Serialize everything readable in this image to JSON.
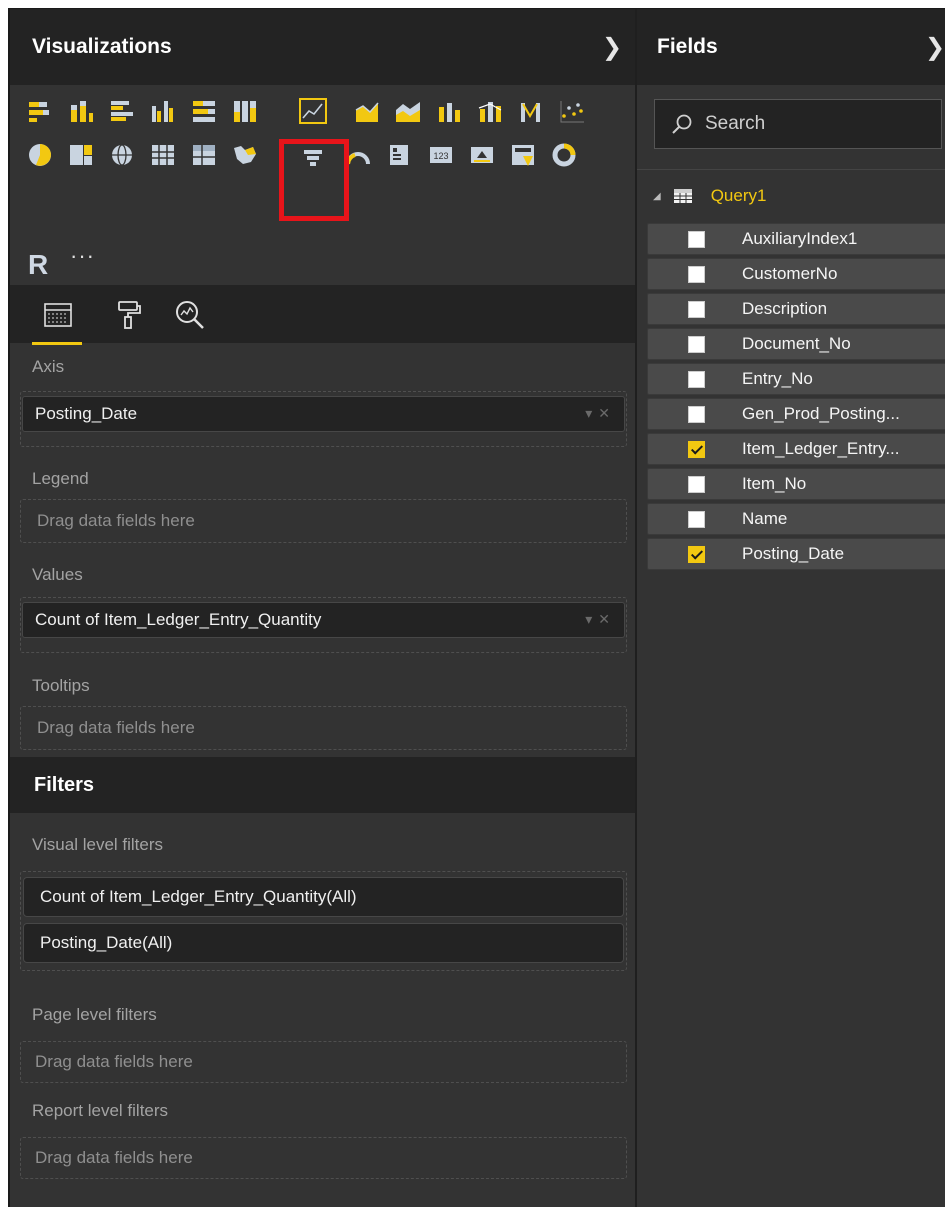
{
  "visualizations": {
    "title": "Visualizations",
    "gallery_icons_row1": [
      "stacked-bar-icon",
      "stacked-column-icon",
      "clustered-bar-icon",
      "clustered-column-icon",
      "100-stacked-bar-icon",
      "100-stacked-column-icon",
      "line-chart-icon",
      "area-chart-icon",
      "stacked-area-icon",
      "line-clustered-column-icon",
      "line-stacked-column-icon",
      "ribbon-chart-icon",
      "scatter-chart-icon"
    ],
    "gallery_icons_row2": [
      "pie-chart-icon",
      "treemap-icon",
      "map-icon",
      "table-icon",
      "matrix-icon",
      "filled-map-icon",
      "funnel-icon",
      "gauge-icon",
      "multi-row-card-icon",
      "card-icon",
      "kpi-icon",
      "slicer-icon",
      "donut-chart-icon"
    ],
    "selected_visual": "line-chart-icon",
    "r_label": "R",
    "more_label": "···"
  },
  "build": {
    "axis_label": "Axis",
    "axis_field": "Posting_Date",
    "legend_label": "Legend",
    "legend_placeholder": "Drag data fields here",
    "values_label": "Values",
    "values_field": "Count of Item_Ledger_Entry_Quantity",
    "tooltips_label": "Tooltips",
    "tooltips_placeholder": "Drag data fields here"
  },
  "filters": {
    "title": "Filters",
    "visual_level_label": "Visual level filters",
    "visual_level_items": [
      "Count of Item_Ledger_Entry_Quantity(All)",
      "Posting_Date(All)"
    ],
    "page_level_label": "Page level filters",
    "page_level_placeholder": "Drag data fields here",
    "report_level_label": "Report level filters",
    "report_level_placeholder": "Drag data fields here"
  },
  "fields": {
    "title": "Fields",
    "search_placeholder": "Search",
    "table_name": "Query1",
    "items": [
      {
        "name": "AuxiliaryIndex1",
        "checked": false
      },
      {
        "name": "CustomerNo",
        "checked": false
      },
      {
        "name": "Description",
        "checked": false
      },
      {
        "name": "Document_No",
        "checked": false
      },
      {
        "name": "Entry_No",
        "checked": false
      },
      {
        "name": "Gen_Prod_Posting...",
        "checked": false
      },
      {
        "name": "Item_Ledger_Entry...",
        "checked": true
      },
      {
        "name": "Item_No",
        "checked": false
      },
      {
        "name": "Name",
        "checked": false
      },
      {
        "name": "Posting_Date",
        "checked": true
      }
    ]
  },
  "colors": {
    "accent": "#f2c811",
    "highlight": "#e8141a",
    "pane_bg": "#333333",
    "header_bg": "#232323"
  }
}
